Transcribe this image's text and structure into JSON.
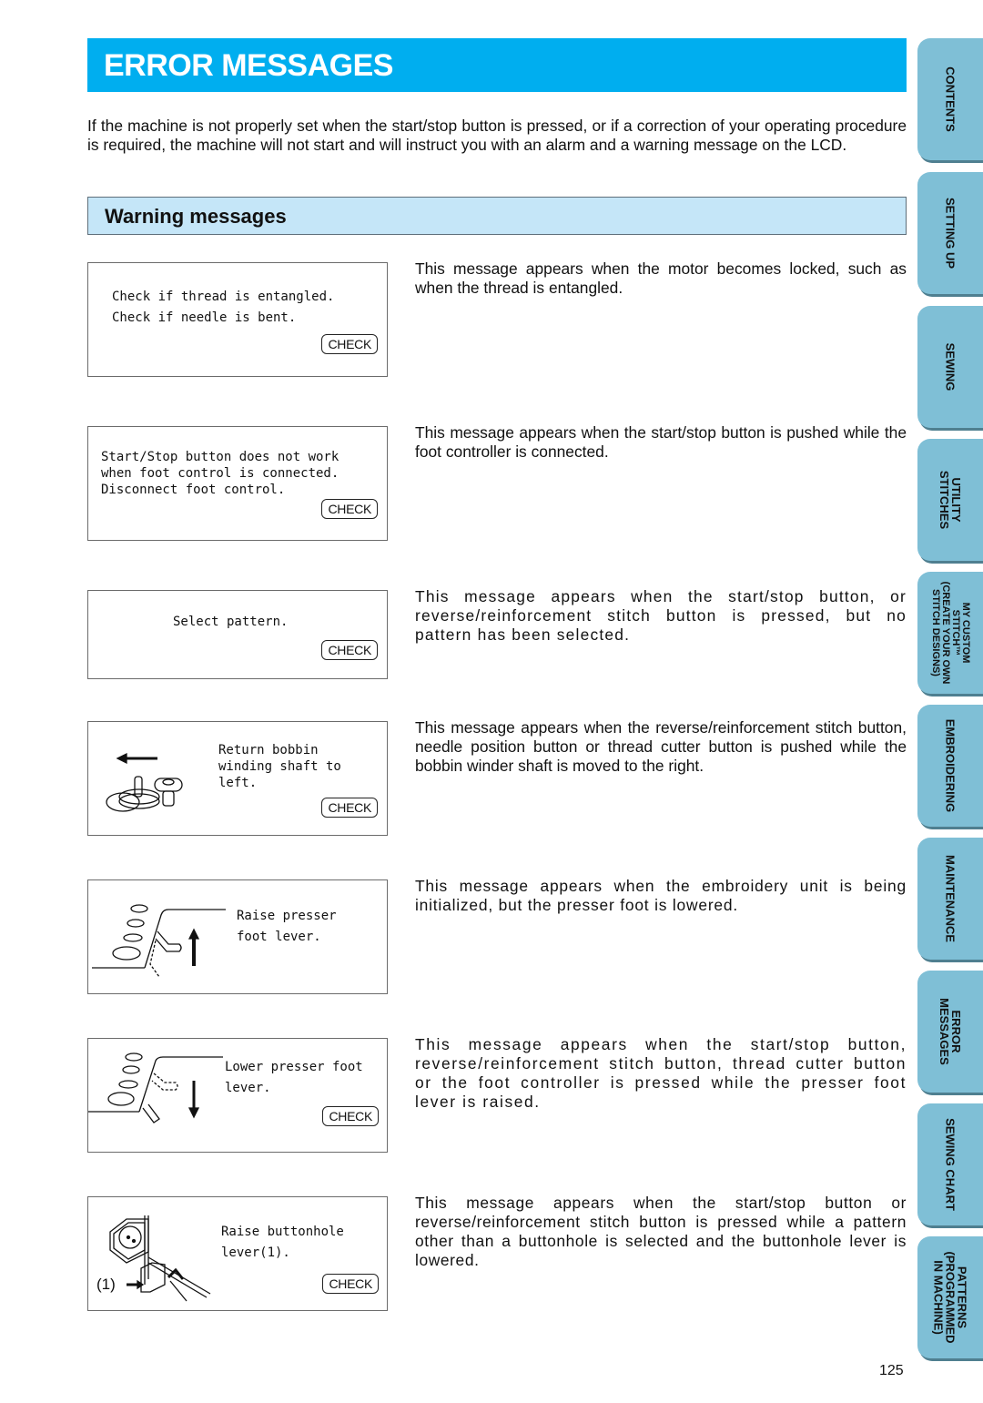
{
  "page": {
    "title": "ERROR MESSAGES",
    "intro": "If the machine is not properly set when the start/stop button is pressed, or if a correction of your operating procedure is required, the machine will not start and will instruct you with an alarm and a warning message on the LCD.",
    "section_title": "Warning messages",
    "page_number": "125"
  },
  "colors": {
    "title_bar": "#00aeef",
    "section_bar": "#c5e6f8",
    "tab": "#7fbfd6"
  },
  "messages": [
    {
      "lcd_text": "Check if thread is entangled.\nCheck if needle is bent.",
      "button": "CHECK",
      "illustration": null,
      "description": "This message appears when the motor becomes locked, such as when the thread is entangled."
    },
    {
      "lcd_text": "Start/Stop button does not work\nwhen foot control is connected.\nDisconnect foot control.",
      "button": "CHECK",
      "illustration": null,
      "description": "This message appears when the start/stop button is pushed while the foot controller is connected."
    },
    {
      "lcd_text": "Select pattern.",
      "button": "CHECK",
      "illustration": null,
      "description": "This message appears when the start/stop button, or reverse/reinforcement stitch button is pressed, but no pattern has been selected."
    },
    {
      "lcd_text": "Return bobbin\nwinding shaft to\nleft.",
      "button": "CHECK",
      "illustration": "bobbin-winder-icon",
      "description": "This message appears when the reverse/reinforcement stitch button, needle position button or thread cutter button is pushed while the bobbin winder shaft is moved to the right."
    },
    {
      "lcd_text": "Raise presser\nfoot lever.",
      "button": null,
      "illustration": "presser-foot-raise-icon",
      "description": "This message appears when the embroidery unit is being initialized, but the presser foot is lowered."
    },
    {
      "lcd_text": "Lower presser foot\nlever.",
      "button": "CHECK",
      "illustration": "presser-foot-lower-icon",
      "description": "This message appears when the start/stop button, reverse/reinforcement stitch button, thread cutter button or the foot controller is pressed while the presser foot lever is raised."
    },
    {
      "lcd_text": "Raise buttonhole\nlever(1).",
      "button": "CHECK",
      "illustration": "buttonhole-lever-icon",
      "illustration_label": "(1)",
      "description": "This message appears when the start/stop button or reverse/reinforcement stitch button is pressed while a pattern other than a buttonhole is selected and the buttonhole lever is lowered."
    }
  ],
  "tabs": [
    {
      "label": "CONTENTS"
    },
    {
      "label": "SETTING UP"
    },
    {
      "label": "SEWING"
    },
    {
      "label": "UTILITY\nSTITCHES"
    },
    {
      "label": "MY CUSTOM\nSTITCH™\n(CREATE YOUR OWN\nSTITCH DESIGNS)"
    },
    {
      "label": "EMBROIDERING"
    },
    {
      "label": "MAINTENANCE"
    },
    {
      "label": "ERROR\nMESSAGES"
    },
    {
      "label": "SEWING CHART"
    },
    {
      "label": "PATTERNS\n(PROGRAMMED\nIN MACHINE)"
    }
  ]
}
